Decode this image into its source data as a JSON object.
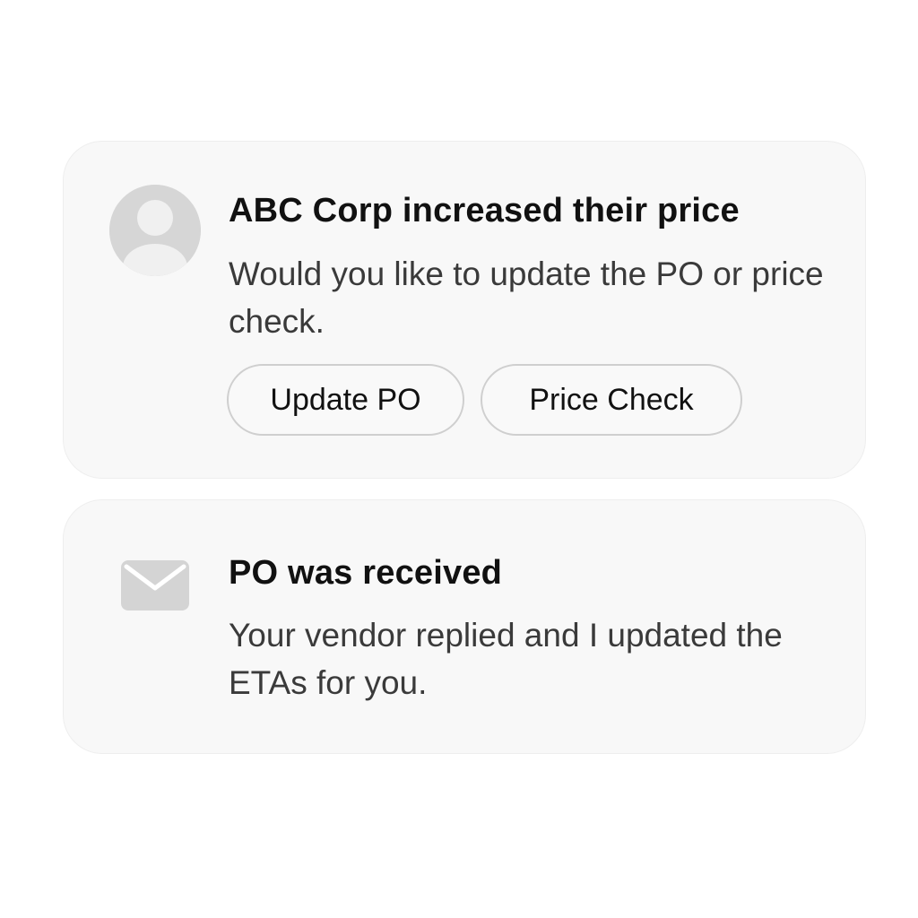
{
  "notifications": [
    {
      "icon": "user-avatar-icon",
      "title": "ABC Corp increased their price",
      "body": "Would you like to update the PO or price check.",
      "actions": {
        "update_po_label": "Update PO",
        "price_check_label": "Price Check"
      }
    },
    {
      "icon": "envelope-icon",
      "title": "PO was received",
      "body": "Your vendor replied and I updated the ETAs for you."
    }
  ],
  "colors": {
    "card_background": "#f8f8f8",
    "avatar_gray": "#d6d6d6",
    "button_border": "#cfcfcf",
    "title_text": "#111111",
    "body_text": "#3a3a3a"
  }
}
